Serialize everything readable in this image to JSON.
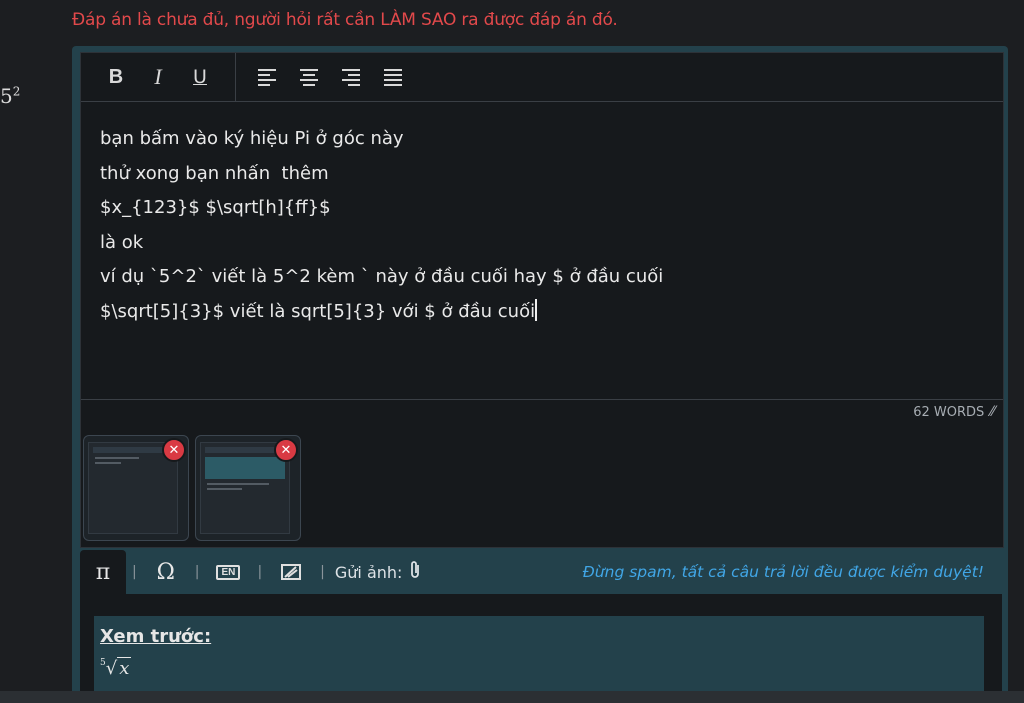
{
  "gutter": {
    "text": "5",
    "sup": "2"
  },
  "warning_text": "Đáp án là chưa đủ, người hỏi rất cần LÀM SAO ra được đáp án đó.",
  "toolbar": {
    "bold": "B",
    "italic": "I",
    "underline": "U",
    "align_icons": [
      "align-left-icon",
      "align-center-icon",
      "align-right-icon",
      "align-justify-icon"
    ]
  },
  "editor": {
    "lines": [
      "bạn bấm vào ký hiệu Pi ở góc này",
      "thử xong bạn nhấn  thêm",
      "$x_{123}$ $\\sqrt[h]{ff}$",
      "là ok",
      "ví dụ `5^2` viết là 5^2 kèm ` này ở đầu cuối hay $ ở đầu cuối",
      "$\\sqrt[5]{3}$ viết là sqrt[5]{3} với $ ở đầu cuối"
    ],
    "word_count": "62 WORDS"
  },
  "attachments": [
    {
      "name": "screenshot-1"
    },
    {
      "name": "screenshot-2"
    }
  ],
  "bottom_bar": {
    "pi": "π",
    "omega": "Ω",
    "keyboard_label": "EN",
    "send_image_label": "Gửi ảnh:",
    "spam_notice": "Đừng spam, tất cả câu trả lời đều được kiểm duyệt!"
  },
  "preview": {
    "title": "Xem trước:",
    "radical_index": "5",
    "radical_symbol": "√",
    "radicand": "x"
  },
  "colors": {
    "warning": "#e2494b",
    "accent_teal": "#23414b",
    "spam_blue": "#41a6e6",
    "remove_red": "#d93a43"
  }
}
